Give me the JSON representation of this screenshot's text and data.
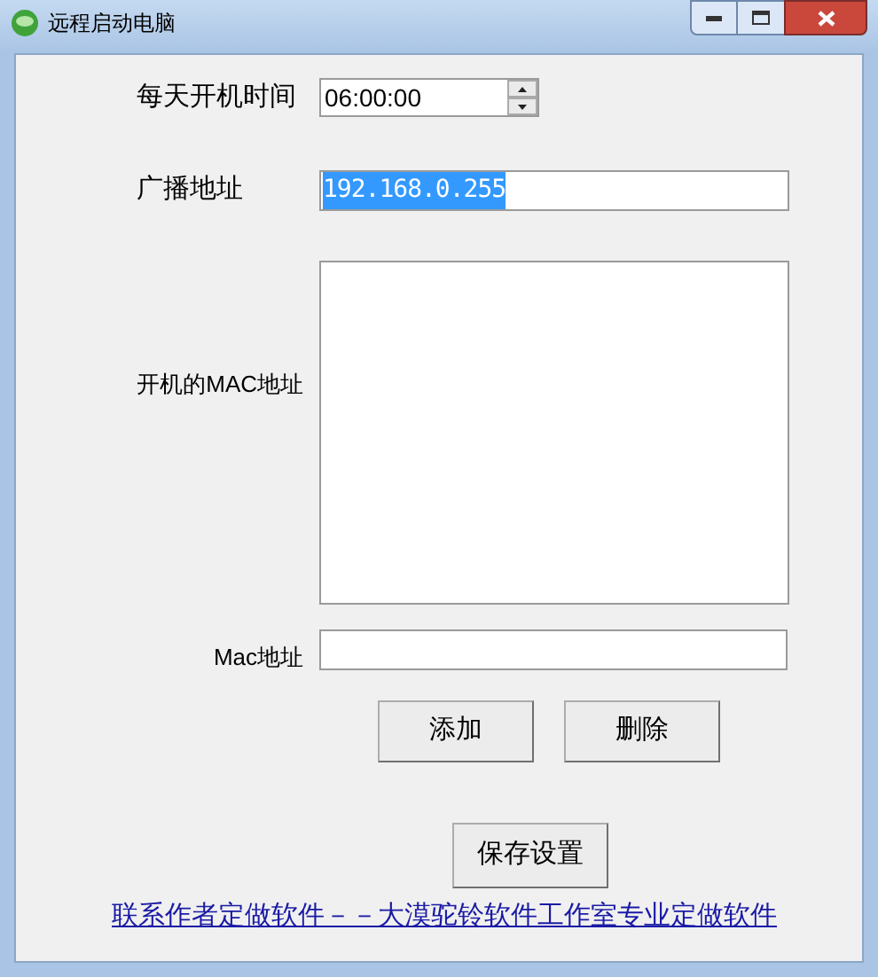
{
  "window": {
    "title": "远程启动电脑"
  },
  "time": {
    "label": "每天开机时间",
    "value": "06:00:00"
  },
  "broadcast": {
    "label": "广播地址",
    "value": "192.168.0.255",
    "selected": true
  },
  "mac_list": {
    "label": "开机的MAC地址"
  },
  "mac_field": {
    "label": "Mac地址"
  },
  "buttons": [
    "添加",
    "删除"
  ],
  "save_button": "保存设置",
  "link": "联系作者定做软件－－大漠驼铃软件工作室专业定做软件"
}
